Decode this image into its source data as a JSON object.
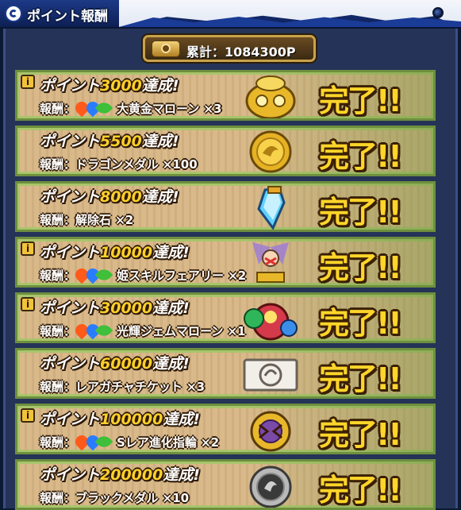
{
  "header": {
    "title": "ポイント報酬"
  },
  "total": {
    "label": "累計：1084300P"
  },
  "rows": [
    {
      "info": "i",
      "prefix": "ポイント",
      "points": "3000",
      "suffix": "達成!",
      "reward_label": "報酬：",
      "reward_item": "大黄金マローン ×3",
      "attributes": true,
      "art": "golden-marron",
      "status": "完了!!"
    },
    {
      "info": "",
      "prefix": "ポイント",
      "points": "5500",
      "suffix": "達成!",
      "reward_label": "報酬：",
      "reward_item": "ドラゴンメダル ×100",
      "attributes": false,
      "art": "dragon-medal",
      "status": "完了!!"
    },
    {
      "info": "",
      "prefix": "ポイント",
      "points": "8000",
      "suffix": "達成!",
      "reward_label": "報酬：",
      "reward_item": "解除石 ×2",
      "attributes": false,
      "art": "release-stone",
      "status": "完了!!"
    },
    {
      "info": "i",
      "prefix": "ポイント",
      "points": "10000",
      "suffix": "達成!",
      "reward_label": "報酬：",
      "reward_item": "姫スキルフェアリー ×2",
      "attributes": true,
      "art": "skill-fairy",
      "status": "完了!!"
    },
    {
      "info": "i",
      "prefix": "ポイント",
      "points": "30000",
      "suffix": "達成!",
      "reward_label": "報酬：",
      "reward_item": "光輝ジェムマローン ×1",
      "attributes": true,
      "art": "gem-marron",
      "status": "完了!!"
    },
    {
      "info": "",
      "prefix": "ポイント",
      "points": "60000",
      "suffix": "達成!",
      "reward_label": "報酬：",
      "reward_item": "レアガチャチケット ×3",
      "attributes": false,
      "art": "gacha-ticket",
      "status": "完了!!"
    },
    {
      "info": "i",
      "prefix": "ポイント",
      "points": "100000",
      "suffix": "達成!",
      "reward_label": "報酬：",
      "reward_item": "Sレア進化指輪 ×2",
      "attributes": true,
      "art": "evolution-ring",
      "status": "完了!!"
    },
    {
      "info": "",
      "prefix": "ポイント",
      "points": "200000",
      "suffix": "達成!",
      "reward_label": "報酬：",
      "reward_item": "ブラックメダル ×10",
      "attributes": false,
      "art": "black-medal",
      "status": "完了!!"
    }
  ],
  "colors": {
    "header_bg": "#13296a",
    "panel_bg": "#243357",
    "row_bg": "#d9b98a",
    "row_border": "#6e8f3e",
    "points_color": "#ffd02a",
    "complete_color": "#ffd52a"
  }
}
